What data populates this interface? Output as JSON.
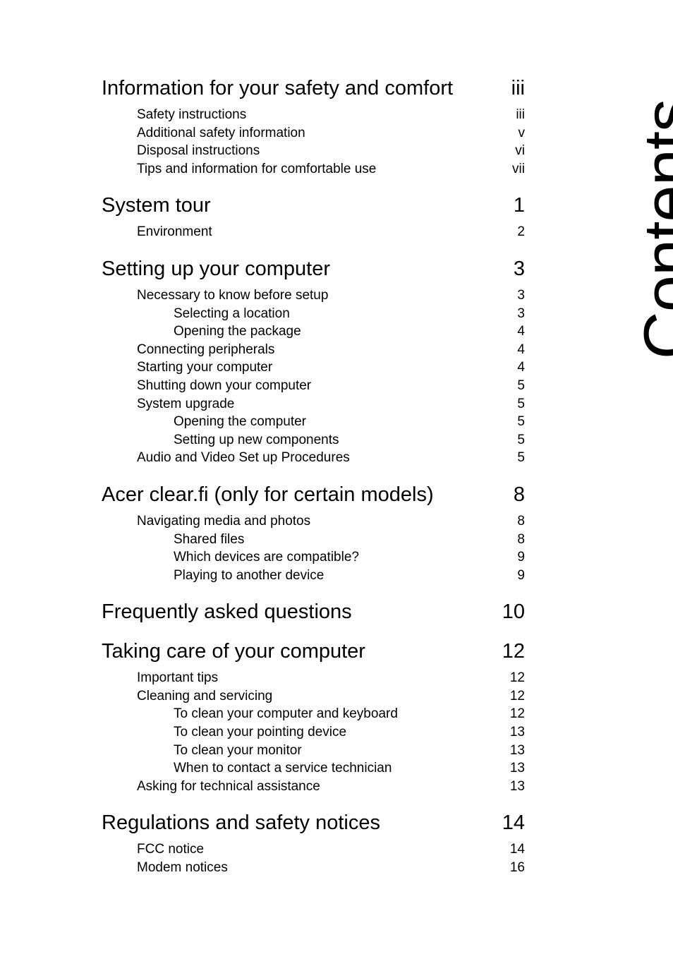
{
  "document": {
    "vertical_title": "Contents",
    "page_background": "#ffffff",
    "text_color": "#000000"
  },
  "toc": {
    "entries": [
      {
        "level": 0,
        "label": "Information for your safety and comfort",
        "page": "iii"
      },
      {
        "level": 1,
        "label": "Safety instructions",
        "page": "iii"
      },
      {
        "level": 1,
        "label": "Additional safety information",
        "page": "v"
      },
      {
        "level": 1,
        "label": "Disposal instructions",
        "page": "vi"
      },
      {
        "level": 1,
        "label": "Tips and information for comfortable use",
        "page": "vii"
      },
      {
        "level": 0,
        "label": "System tour",
        "page": "1"
      },
      {
        "level": 1,
        "label": "Environment",
        "page": "2"
      },
      {
        "level": 0,
        "label": "Setting up your computer",
        "page": "3"
      },
      {
        "level": 1,
        "label": "Necessary to know before setup",
        "page": "3"
      },
      {
        "level": 2,
        "label": "Selecting a location",
        "page": "3"
      },
      {
        "level": 2,
        "label": "Opening the package",
        "page": "4"
      },
      {
        "level": 1,
        "label": "Connecting peripherals",
        "page": "4"
      },
      {
        "level": 1,
        "label": "Starting your computer",
        "page": "4"
      },
      {
        "level": 1,
        "label": "Shutting down your computer",
        "page": "5"
      },
      {
        "level": 1,
        "label": "System upgrade",
        "page": "5"
      },
      {
        "level": 2,
        "label": "Opening the computer",
        "page": "5"
      },
      {
        "level": 2,
        "label": "Setting up new components",
        "page": "5"
      },
      {
        "level": 1,
        "label": "Audio and Video Set up Procedures",
        "page": "5"
      },
      {
        "level": 0,
        "label": "Acer clear.fi (only for certain models)",
        "page": "8"
      },
      {
        "level": 1,
        "label": "Navigating media and photos",
        "page": "8"
      },
      {
        "level": 2,
        "label": "Shared files",
        "page": "8"
      },
      {
        "level": 2,
        "label": "Which devices are compatible?",
        "page": "9"
      },
      {
        "level": 2,
        "label": "Playing to another device",
        "page": "9"
      },
      {
        "level": 0,
        "label": "Frequently asked questions",
        "page": "10"
      },
      {
        "level": 0,
        "label": "Taking care of your computer",
        "page": "12"
      },
      {
        "level": 1,
        "label": "Important tips",
        "page": "12"
      },
      {
        "level": 1,
        "label": "Cleaning and servicing",
        "page": "12"
      },
      {
        "level": 2,
        "label": "To clean your computer and keyboard",
        "page": "12"
      },
      {
        "level": 2,
        "label": "To clean your pointing device",
        "page": "13"
      },
      {
        "level": 2,
        "label": "To clean your monitor",
        "page": "13"
      },
      {
        "level": 2,
        "label": "When to contact a service technician",
        "page": "13"
      },
      {
        "level": 1,
        "label": "Asking for technical assistance",
        "page": "13"
      },
      {
        "level": 0,
        "label": "Regulations and safety notices",
        "page": "14"
      },
      {
        "level": 1,
        "label": "FCC notice",
        "page": "14"
      },
      {
        "level": 1,
        "label": "Modem notices",
        "page": "16"
      }
    ]
  }
}
